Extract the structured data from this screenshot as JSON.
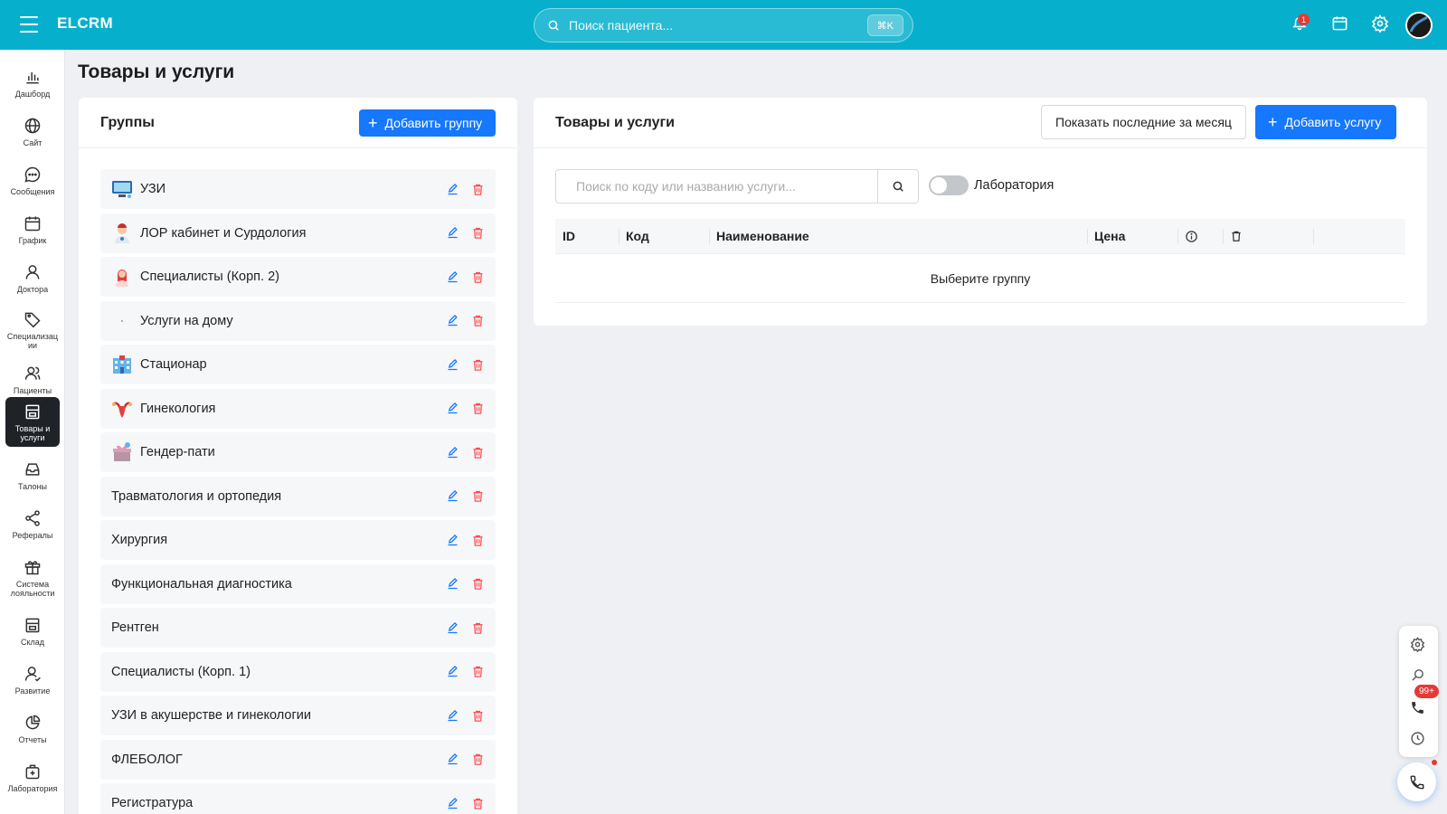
{
  "app": {
    "brand": "ELCRM"
  },
  "header": {
    "search_placeholder": "Поиск пациента...",
    "search_shortcut": "⌘K",
    "notification_count": "1"
  },
  "sidebar": {
    "items": [
      {
        "label": "Дашборд",
        "icon": "bar-chart-icon"
      },
      {
        "label": "Сайт",
        "icon": "globe-icon"
      },
      {
        "label": "Сообщения",
        "icon": "chat-icon"
      },
      {
        "label": "График",
        "icon": "calendar-icon"
      },
      {
        "label": "Доктора",
        "icon": "user-icon"
      },
      {
        "label": "Специализации",
        "icon": "tag-icon"
      },
      {
        "label": "Пациенты",
        "icon": "users-icon"
      },
      {
        "label": "Товары и услуги",
        "icon": "store-icon",
        "active": true
      },
      {
        "label": "Талоны",
        "icon": "inbox-icon"
      },
      {
        "label": "Рефералы",
        "icon": "share-icon"
      },
      {
        "label": "Система лояльности",
        "icon": "gift-icon"
      },
      {
        "label": "Склад",
        "icon": "warehouse-icon"
      },
      {
        "label": "Развитие",
        "icon": "user-growth-icon"
      },
      {
        "label": "Отчеты",
        "icon": "pie-chart-icon"
      },
      {
        "label": "Лаборатория",
        "icon": "lab-icon"
      }
    ]
  },
  "page": {
    "title": "Товары и услуги"
  },
  "groups_panel": {
    "title": "Группы",
    "add_button": "Добавить группу",
    "groups": [
      {
        "name": "УЗИ",
        "icon": "ultrasound-icon"
      },
      {
        "name": "ЛОР кабинет и Сурдология",
        "icon": "doctor-icon"
      },
      {
        "name": "Специалисты (Корп. 2)",
        "icon": "specialist-icon"
      },
      {
        "name": "Услуги на дому",
        "icon": "dot-icon"
      },
      {
        "name": "Стационар",
        "icon": "hospital-icon"
      },
      {
        "name": "Гинекология",
        "icon": "uterus-icon"
      },
      {
        "name": "Гендер-пати",
        "icon": "gift-box-icon"
      },
      {
        "name": "Травматология и ортопедия",
        "icon": ""
      },
      {
        "name": "Хирургия",
        "icon": ""
      },
      {
        "name": "Функциональная диагностика",
        "icon": ""
      },
      {
        "name": "Рентген",
        "icon": ""
      },
      {
        "name": "Специалисты (Корп. 1)",
        "icon": ""
      },
      {
        "name": "УЗИ в акушерстве и гинекологии",
        "icon": ""
      },
      {
        "name": "ФЛЕБОЛОГ",
        "icon": ""
      },
      {
        "name": "Регистратура",
        "icon": ""
      }
    ]
  },
  "services_panel": {
    "title": "Товары и услуги",
    "show_recent_button": "Показать последние за месяц",
    "add_button": "Добавить услугу",
    "search_placeholder": "Поиск по коду или названию услуги...",
    "lab_toggle_label": "Лаборатория",
    "columns": [
      "ID",
      "Код",
      "Наименование",
      "Цена"
    ],
    "empty_text": "Выберите группу"
  },
  "float_widget": {
    "badge": "99+"
  },
  "colors": {
    "header": "#06b0cc",
    "primary": "#1677ff",
    "edit": "#1677ff",
    "delete": "#ff4d4f"
  }
}
